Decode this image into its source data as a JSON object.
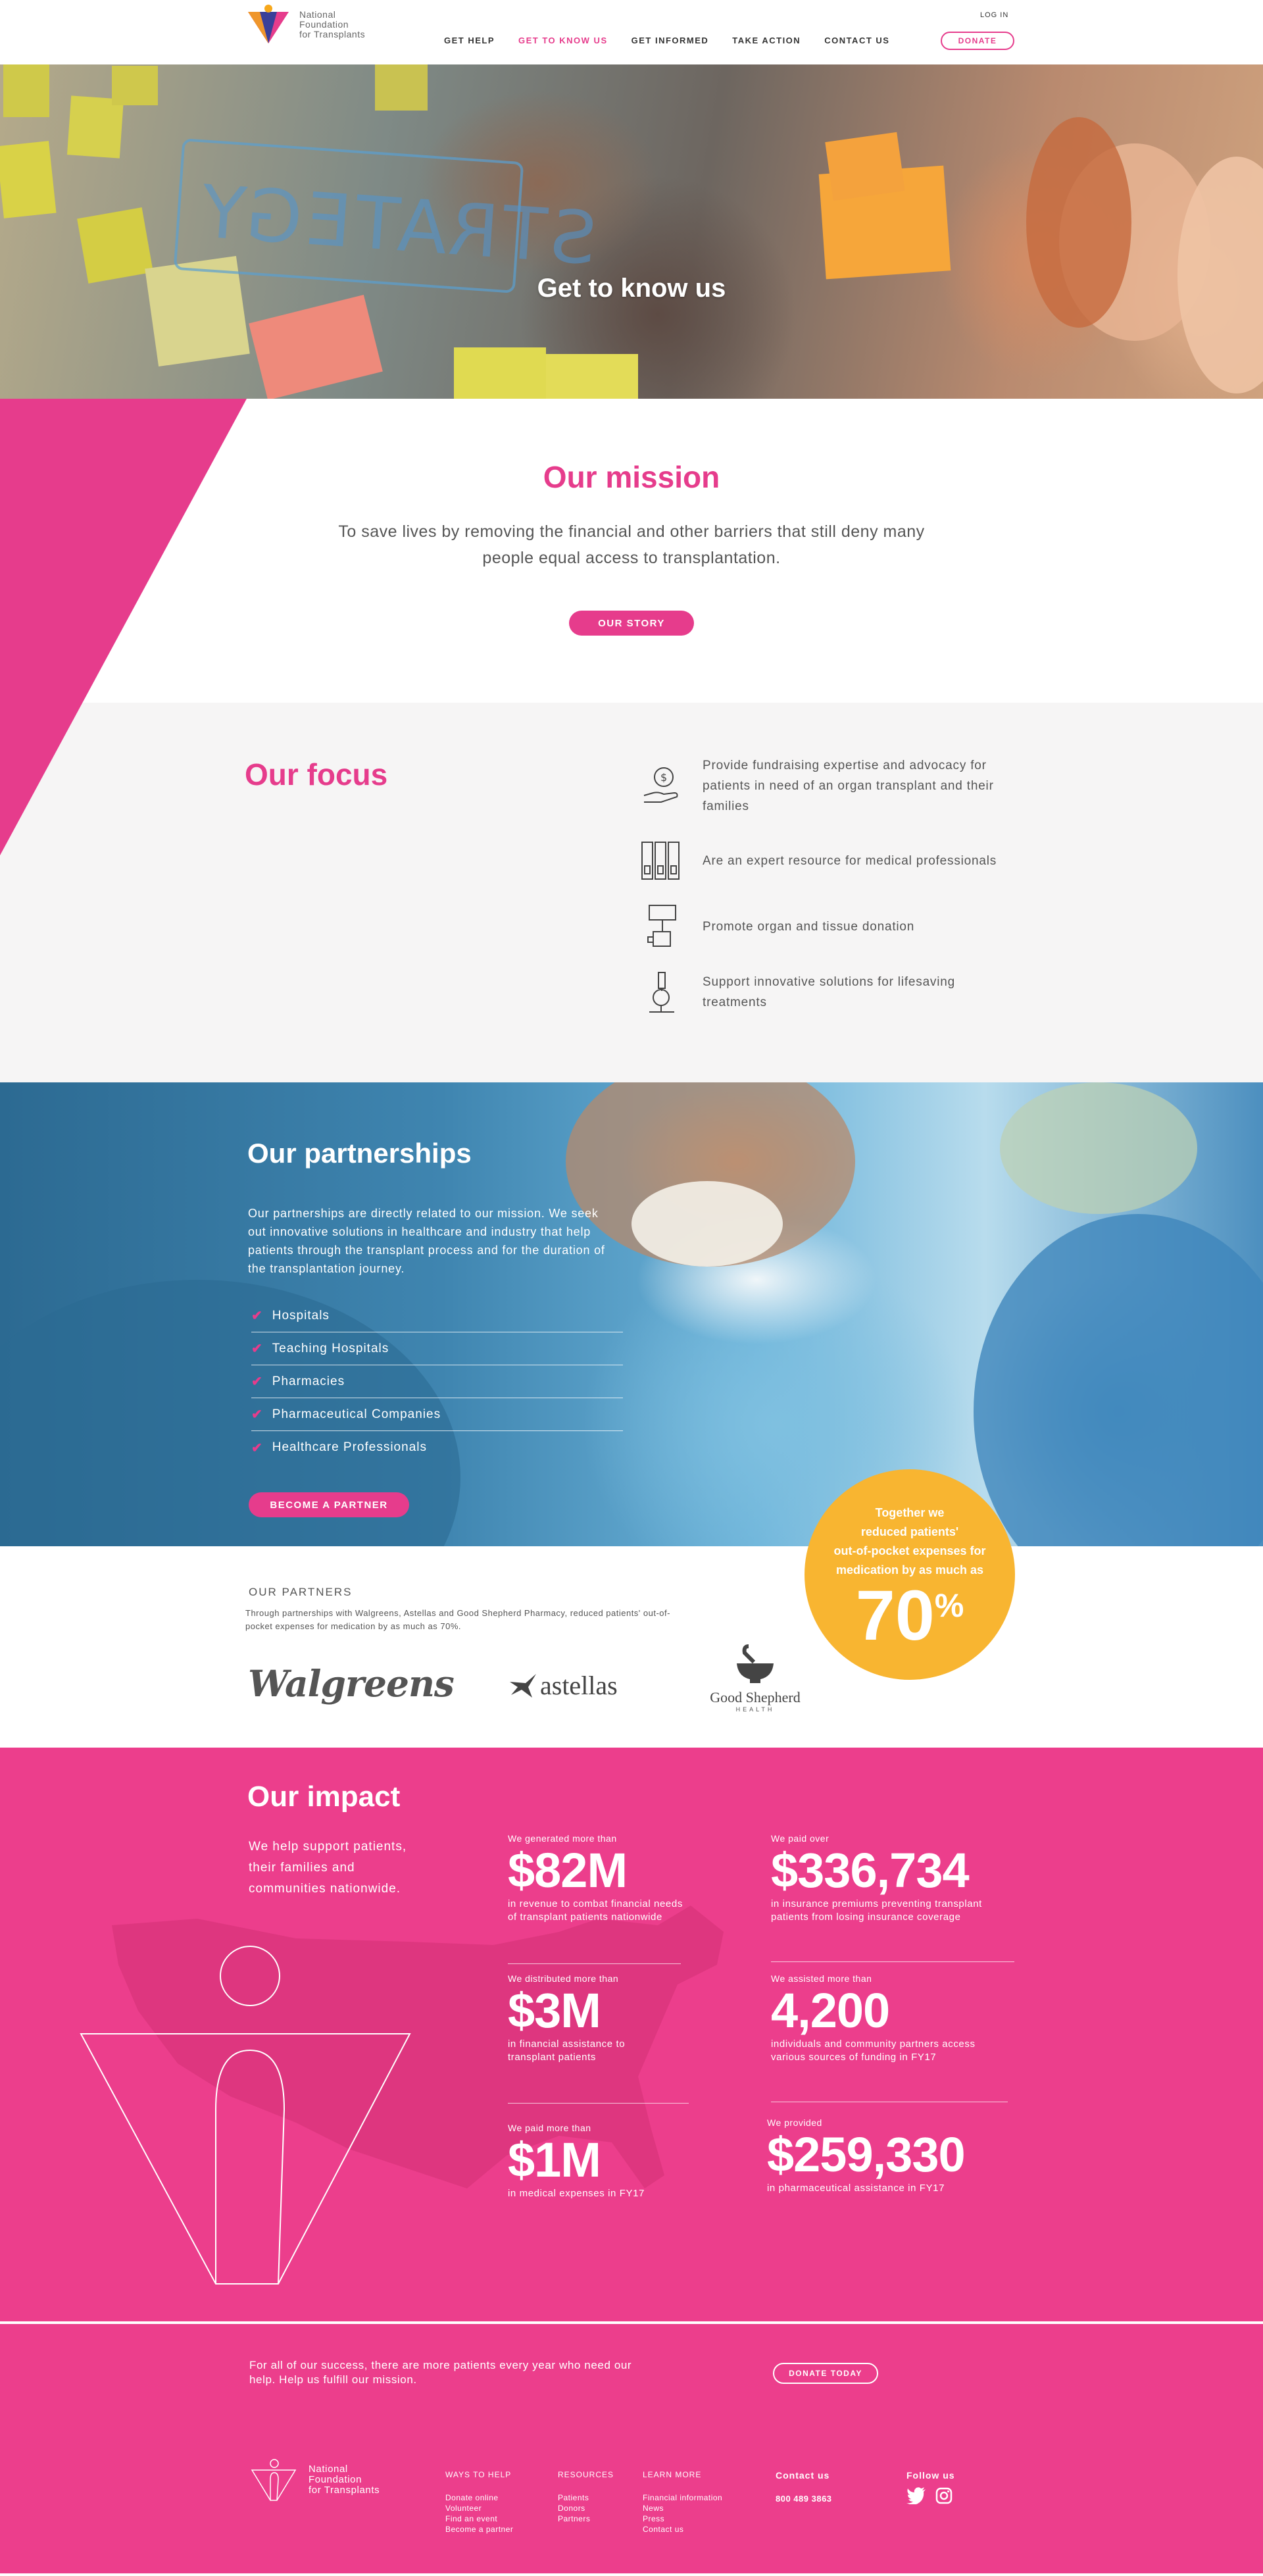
{
  "header": {
    "logo_text": [
      "National",
      "Foundation",
      "for Transplants"
    ],
    "login": "LOG IN",
    "nav": [
      {
        "label": "GET HELP",
        "active": false
      },
      {
        "label": "GET TO KNOW US",
        "active": true
      },
      {
        "label": "GET INFORMED",
        "active": false
      },
      {
        "label": "TAKE ACTION",
        "active": false
      },
      {
        "label": "CONTACT US",
        "active": false
      }
    ],
    "donate": "DONATE"
  },
  "hero": {
    "title": "Get to know us",
    "glass_text": "STRATEGY"
  },
  "mission": {
    "title": "Our mission",
    "text": "To save lives by removing the financial and other barriers that still deny many people equal access to transplantation.",
    "button": "OUR STORY"
  },
  "focus": {
    "title": "Our focus",
    "items": [
      {
        "icon": "money-hand-icon",
        "text": "Provide fundraising expertise and advocacy for patients in need of an organ transplant and their families"
      },
      {
        "icon": "binders-icon",
        "text": "Are an expert resource for medical professionals"
      },
      {
        "icon": "sign-hand-icon",
        "text": "Promote organ and tissue donation"
      },
      {
        "icon": "microscope-icon",
        "text": "Support innovative solutions for lifesaving treatments"
      }
    ]
  },
  "partnerships": {
    "title": "Our partnerships",
    "intro": "Our partnerships are directly related to our mission. We seek out innovative solutions in healthcare and industry that help patients through the transplant process and for the duration of the transplantation journey.",
    "items": [
      "Hospitals",
      "Teaching Hospitals",
      "Pharmacies",
      "Pharmaceutical Companies",
      "Healthcare Professionals"
    ],
    "button": "BECOME A PARTNER"
  },
  "our_partners": {
    "title": "OUR PARTNERS",
    "text": "Through partnerships with Walgreens, Astellas and Good Shepherd Pharmacy, reduced patients' out-of-pocket expenses for medication by as much as 70%.",
    "logos": {
      "walgreens": "Walgreens",
      "astellas": "astellas",
      "good_shepherd": "Good Shepherd",
      "good_shepherd_sub": "HEALTH"
    }
  },
  "badge": {
    "lines": [
      "Together we",
      "reduced patients'",
      "out-of-pocket expenses for",
      "medication by as much as"
    ],
    "number": "70",
    "unit": "%"
  },
  "impact": {
    "title": "Our impact",
    "subtitle": "We help support patients, their families and communities nationwide.",
    "stats": [
      {
        "label": "We generated more than",
        "number": "$82M",
        "desc": "in revenue to combat financial needs of transplant patients nationwide"
      },
      {
        "label": "We distributed more than",
        "number": "$3M",
        "desc": "in financial assistance to transplant patients"
      },
      {
        "label": "We paid more than",
        "number": "$1M",
        "desc": "in medical expenses in FY17"
      },
      {
        "label": "We paid over",
        "number": "$336,734",
        "desc": "in insurance premiums preventing transplant patients from losing insurance coverage"
      },
      {
        "label": "We assisted more than",
        "number": "4,200",
        "desc": "individuals and community partners access various sources of funding in FY17"
      },
      {
        "label": "We provided",
        "number": "$259,330",
        "desc": "in pharmaceutical assistance in FY17"
      }
    ]
  },
  "cta": {
    "text": "For all of our success, there are more patients every year who need our help. Help us fulfill our mission.",
    "button": "DONATE TODAY"
  },
  "footer": {
    "logo_text": [
      "National",
      "Foundation",
      "for Transplants"
    ],
    "columns": [
      {
        "heading": "WAYS TO HELP",
        "links": [
          "Donate online",
          "Volunteer",
          "Find an event",
          "Become a partner"
        ]
      },
      {
        "heading": "RESOURCES",
        "links": [
          "Patients",
          "Donors",
          "Partners"
        ]
      },
      {
        "heading": "LEARN MORE",
        "links": [
          "Financial information",
          "News",
          "Press",
          "Contact us"
        ]
      }
    ],
    "contact_heading": "Contact us",
    "phone": "800 489 3863",
    "follow_heading": "Follow us"
  },
  "colors": {
    "brand_pink": "#e63c8c",
    "impact_pink": "#ec3e8c",
    "badge_yellow": "#f8b531",
    "focus_bg": "#f6f5f5"
  }
}
